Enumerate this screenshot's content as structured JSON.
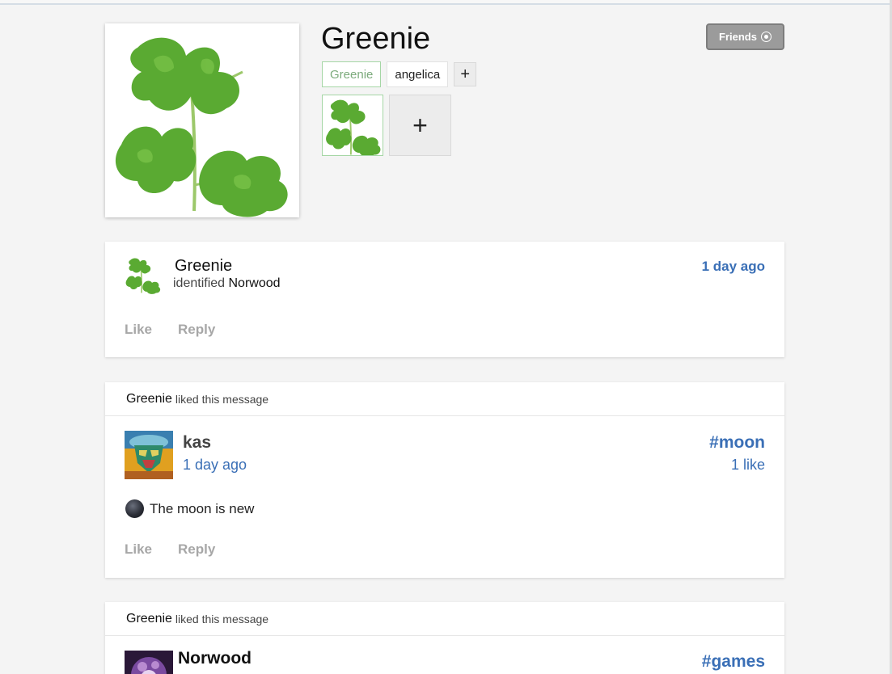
{
  "profile": {
    "name": "Greenie",
    "tags": [
      "Greenie",
      "angelica"
    ],
    "add_tag_label": "+",
    "add_photo_label": "+",
    "friends_button": "Friends"
  },
  "activity": {
    "user": "Greenie",
    "action": "identified",
    "target": "Norwood",
    "time": "1 day ago",
    "like_label": "Like",
    "reply_label": "Reply"
  },
  "liked_posts": [
    {
      "liker": "Greenie",
      "liked_text": "liked this message",
      "author": "kas",
      "time": "1 day ago",
      "channel": "#moon",
      "likes": "1 like",
      "emoji_icon": "new-moon-icon",
      "message": "The moon is new",
      "like_label": "Like",
      "reply_label": "Reply"
    },
    {
      "liker": "Greenie",
      "liked_text": "liked this message",
      "author": "Norwood",
      "channel": "#games"
    }
  ],
  "colors": {
    "link_blue": "#3a6fb6",
    "leaf_green": "#5aaa32",
    "tag_green_border": "#a5d6a5",
    "friends_gray": "#9b9b9b"
  }
}
